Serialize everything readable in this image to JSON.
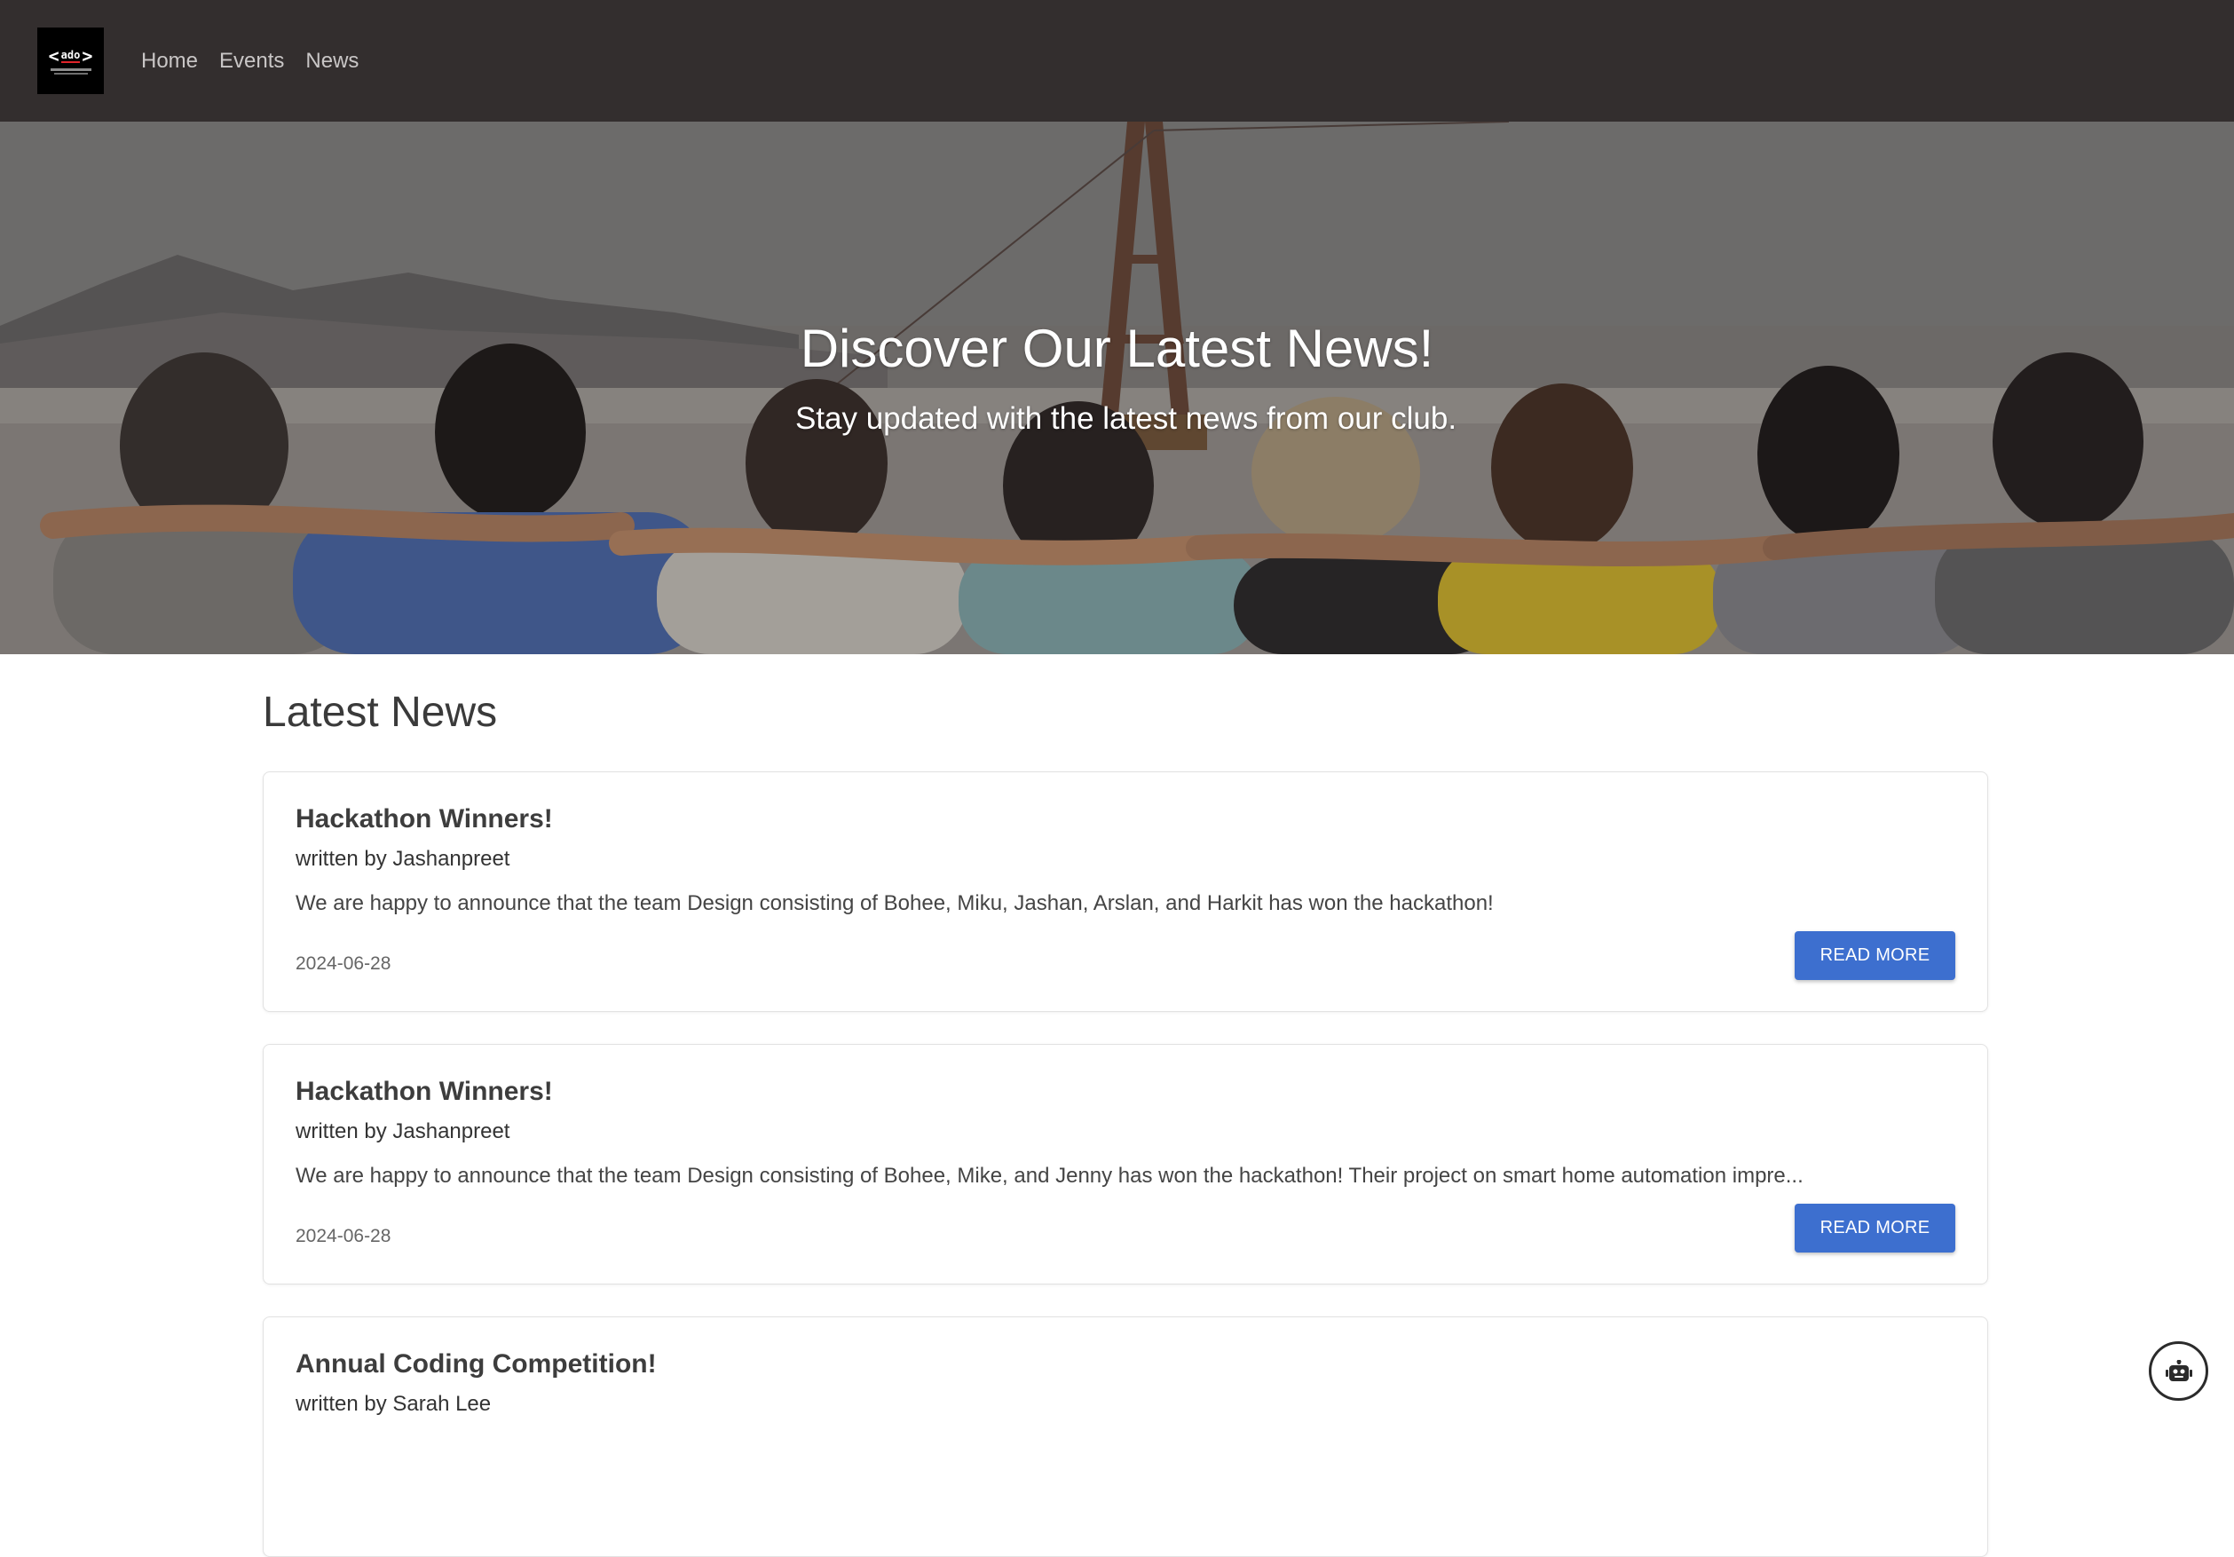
{
  "nav": {
    "logo_text": "<ado>",
    "links": [
      {
        "label": "Home"
      },
      {
        "label": "Events"
      },
      {
        "label": "News"
      }
    ]
  },
  "hero": {
    "title": "Discover Our Latest News!",
    "subtitle": "Stay updated with the latest news from our club."
  },
  "news": {
    "section_title": "Latest News",
    "read_more_label": "READ MORE",
    "items": [
      {
        "title": "Hackathon Winners!",
        "author": "written by Jashanpreet",
        "excerpt": "We are happy to announce that the team Design consisting of Bohee, Miku, Jashan, Arslan, and Harkit has won the hackathon!",
        "date": "2024-06-28"
      },
      {
        "title": "Hackathon Winners!",
        "author": "written by Jashanpreet",
        "excerpt": "We are happy to announce that the team Design consisting of Bohee, Mike, and Jenny has won the hackathon! Their project on smart home automation impre...",
        "date": "2024-06-28"
      },
      {
        "title": "Annual Coding Competition!",
        "author": "written by Sarah Lee",
        "excerpt": "",
        "date": ""
      }
    ]
  },
  "icons": {
    "logo": "club-logo",
    "chatbot": "robot-icon"
  },
  "colors": {
    "navbar_bg": "#332e2e",
    "primary_button": "#3d6fcf",
    "nav_link": "#c9c6c6"
  }
}
